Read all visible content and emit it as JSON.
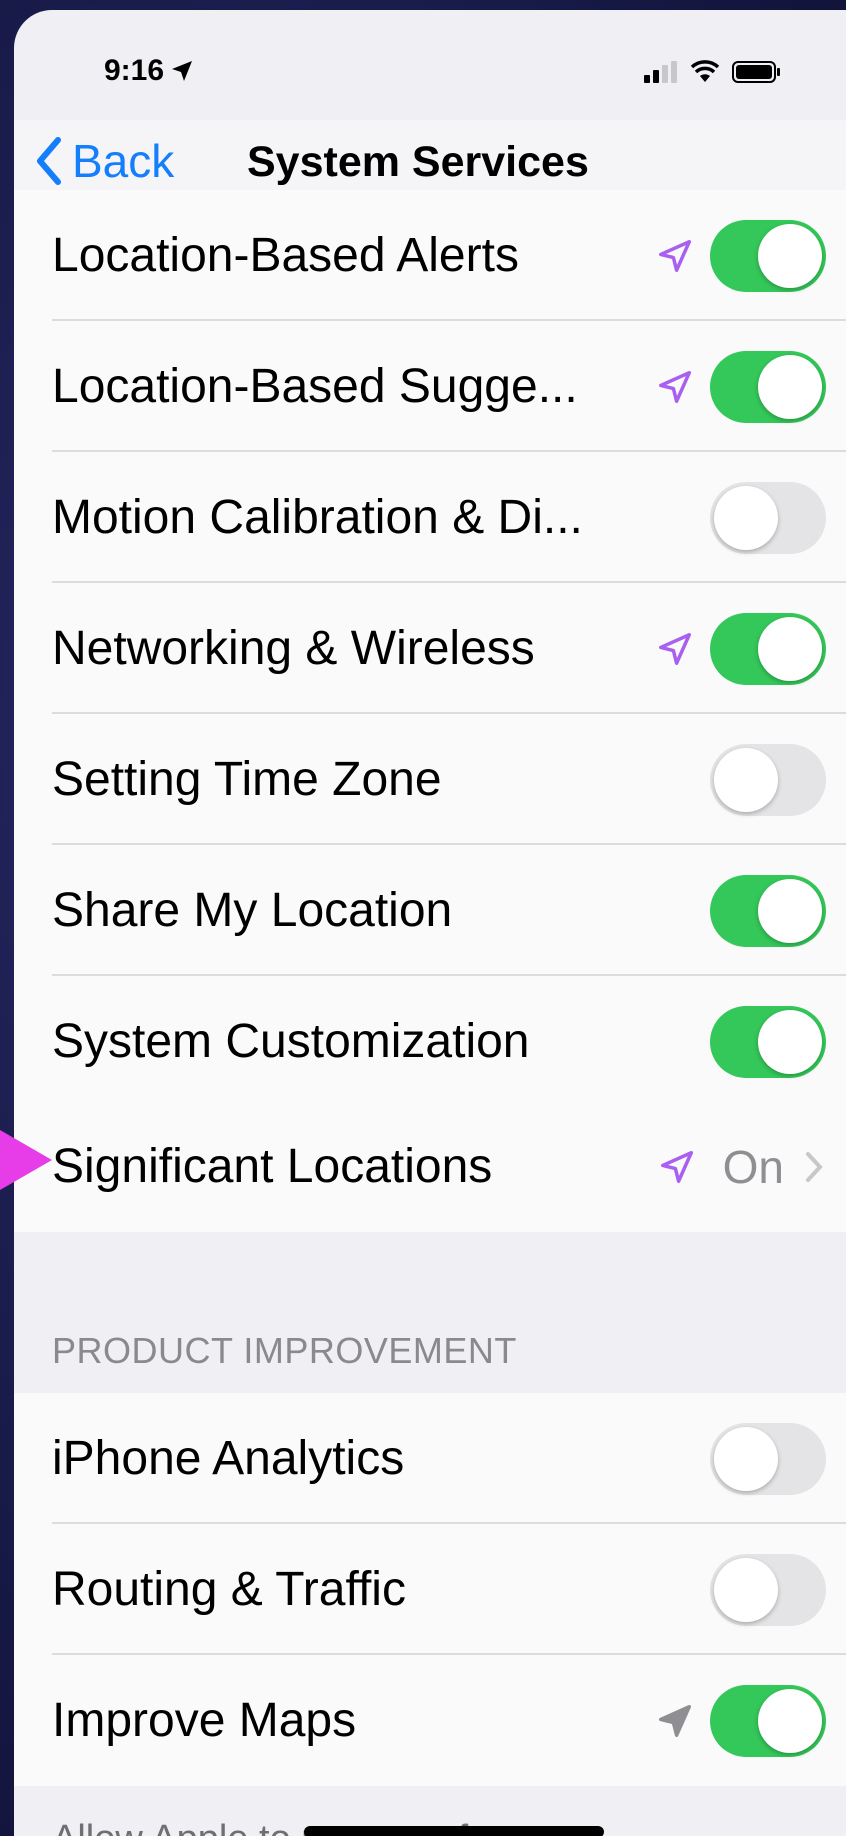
{
  "status_bar": {
    "time": "9:16"
  },
  "nav": {
    "back_label": "Back",
    "title": "System Services"
  },
  "location_rows": [
    {
      "label": "Location-Based Alerts",
      "arrow": "purple",
      "toggle": "on"
    },
    {
      "label": "Location-Based Sugge...",
      "arrow": "purple",
      "toggle": "on"
    },
    {
      "label": "Motion Calibration & Di...",
      "arrow": "none",
      "toggle": "off"
    },
    {
      "label": "Networking & Wireless",
      "arrow": "purple",
      "toggle": "on"
    },
    {
      "label": "Setting Time Zone",
      "arrow": "none",
      "toggle": "off"
    },
    {
      "label": "Share My Location",
      "arrow": "none",
      "toggle": "on"
    },
    {
      "label": "System Customization",
      "arrow": "none",
      "toggle": "on"
    }
  ],
  "significant": {
    "label": "Significant Locations",
    "value": "On"
  },
  "product_improvement": {
    "header": "PRODUCT IMPROVEMENT",
    "rows": [
      {
        "label": "iPhone Analytics",
        "arrow": "none",
        "toggle": "off"
      },
      {
        "label": "Routing & Traffic",
        "arrow": "none",
        "toggle": "off"
      },
      {
        "label": "Improve Maps",
        "arrow": "gray",
        "toggle": "on"
      }
    ]
  },
  "footer": {
    "text": "Allow Apple to use your frequent"
  },
  "colors": {
    "toggle_on": "#34c759",
    "toggle_off": "#e4e4e6",
    "accent": "#147efb",
    "location_arrow": "#a95ff0",
    "pointer": "#e63de8"
  }
}
